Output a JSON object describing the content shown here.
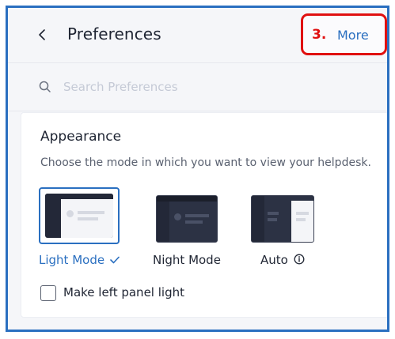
{
  "header": {
    "title": "Preferences",
    "step_number": "3.",
    "more_label": "More",
    "back_icon": "chevron-left-icon"
  },
  "search": {
    "placeholder": "Search Preferences",
    "value": "",
    "icon": "search-icon"
  },
  "appearance": {
    "title": "Appearance",
    "description": "Choose the mode in which you want to view your helpdesk.",
    "options": [
      {
        "label": "Light Mode",
        "selected": true,
        "check_icon": "checkmark-icon"
      },
      {
        "label": "Night Mode",
        "selected": false
      },
      {
        "label": "Auto",
        "selected": false,
        "info_icon": "info-icon"
      }
    ],
    "checkbox": {
      "label": "Make left panel light",
      "checked": false
    }
  },
  "colors": {
    "accent": "#2a6fc0",
    "callout": "#e01010",
    "dark_panel": "#232838",
    "text": "#1f2533"
  }
}
